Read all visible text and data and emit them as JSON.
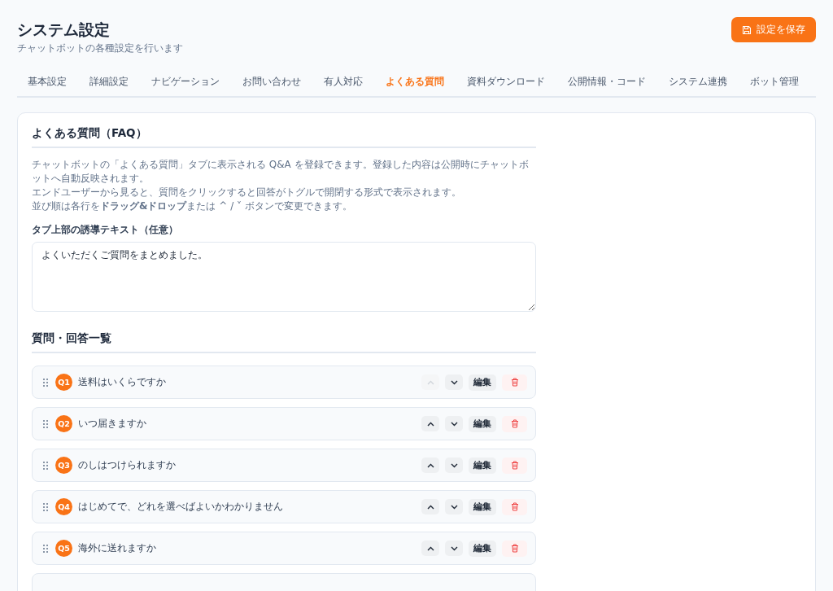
{
  "header": {
    "title": "システム設定",
    "subtitle": "チャットボットの各種設定を行います",
    "save_button": "設定を保存"
  },
  "tabs": [
    {
      "label": "基本設定",
      "selected": false
    },
    {
      "label": "詳細設定",
      "selected": false
    },
    {
      "label": "ナビゲーション",
      "selected": false
    },
    {
      "label": "お問い合わせ",
      "selected": false
    },
    {
      "label": "有人対応",
      "selected": false
    },
    {
      "label": "よくある質問",
      "selected": true
    },
    {
      "label": "資料ダウンロード",
      "selected": false
    },
    {
      "label": "公開情報・コード",
      "selected": false
    },
    {
      "label": "システム連携",
      "selected": false
    },
    {
      "label": "ボット管理",
      "selected": false
    }
  ],
  "section": {
    "title": "よくある質問（FAQ）",
    "description": [
      "チャットボットの「よくある質問」タブに表示される Q&A を登録できます。登録した内容は公開時にチャットボットへ自動反映されます。",
      "エンドユーザーから見ると、質問をクリックすると回答がトグルで開閉する形式で表示されます。",
      "並び順は各行を**ドラッグ&ドロップ**または ^ / ˅ ボタンで変更できます。"
    ],
    "intro_label": "タブ上部の誘導テキスト（任意）",
    "intro_value": "よくいただくご質問をまとめました。",
    "list_title": "質問・回答一覧",
    "items": [
      {
        "badge": "Q1",
        "question": "送料はいくらですか",
        "up_disabled": true,
        "edit_label": "編集"
      },
      {
        "badge": "Q2",
        "question": "いつ届きますか",
        "up_disabled": false,
        "edit_label": "編集"
      },
      {
        "badge": "Q3",
        "question": "のしはつけられますか",
        "up_disabled": false,
        "edit_label": "編集"
      },
      {
        "badge": "Q4",
        "question": "はじめてで、どれを選べばよいかわかりません",
        "up_disabled": false,
        "edit_label": "編集"
      },
      {
        "badge": "Q5",
        "question": "海外に送れますか",
        "up_disabled": false,
        "edit_label": "編集"
      }
    ]
  }
}
